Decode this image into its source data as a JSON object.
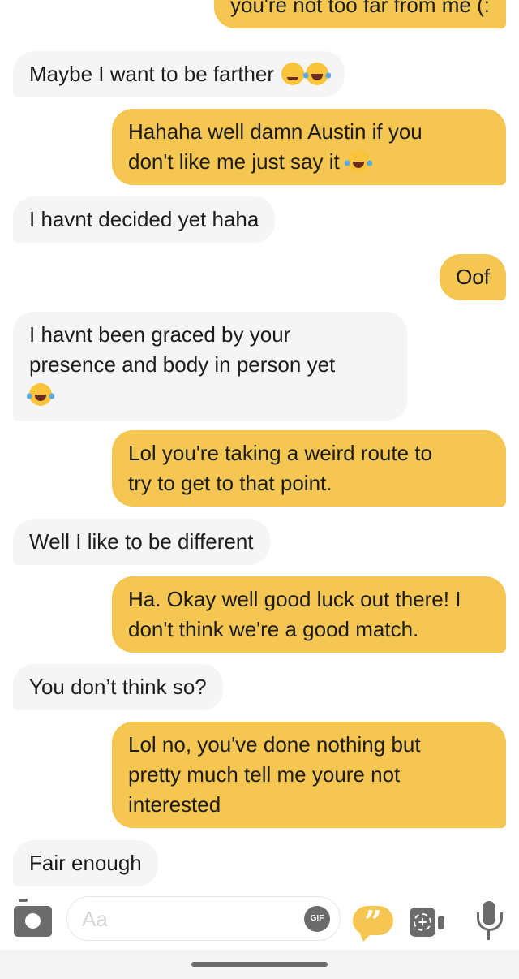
{
  "messages": [
    {
      "side": "sent",
      "text": "you're not too far from me (:",
      "emoji": []
    },
    {
      "side": "recv",
      "text": "Maybe I want to be farther ",
      "emoji": [
        "wink",
        "laugh"
      ]
    },
    {
      "side": "sent",
      "text": "Hahaha well damn Austin if you\ndon't like me just say it ",
      "emoji": [
        "laugh"
      ]
    },
    {
      "side": "recv",
      "text": "I havnt decided yet haha",
      "emoji": []
    },
    {
      "side": "sent",
      "text": "Oof",
      "emoji": []
    },
    {
      "side": "recv",
      "text": "I havnt been graced by your\npresence and body in person yet\n",
      "emoji": [
        "laugh"
      ]
    },
    {
      "side": "sent",
      "text": "Lol you're taking a weird route to\ntry to get to that point.",
      "emoji": []
    },
    {
      "side": "recv",
      "text": "Well I like to be different",
      "emoji": []
    },
    {
      "side": "sent",
      "text": "Ha. Okay well good luck out there! I\ndon't think we're a good match.",
      "emoji": []
    },
    {
      "side": "recv",
      "text": "You don’t think so?",
      "emoji": []
    },
    {
      "side": "sent",
      "text": "Lol no, you've done nothing but\npretty much tell me youre not\ninterested",
      "emoji": []
    },
    {
      "side": "recv",
      "text": "Fair enough",
      "emoji": []
    }
  ],
  "composer": {
    "placeholder": "Aa",
    "gif_label": "GIF",
    "quote_glyph": "”",
    "video_glyph": "+",
    "icons": [
      "camera-icon",
      "gif-icon",
      "quote-icon",
      "video-call-icon",
      "microphone-icon"
    ]
  },
  "colors": {
    "sent_bubble": "#f5c651",
    "received_bubble": "#f5f5f5",
    "icon_gray": "#6b6b6b"
  }
}
